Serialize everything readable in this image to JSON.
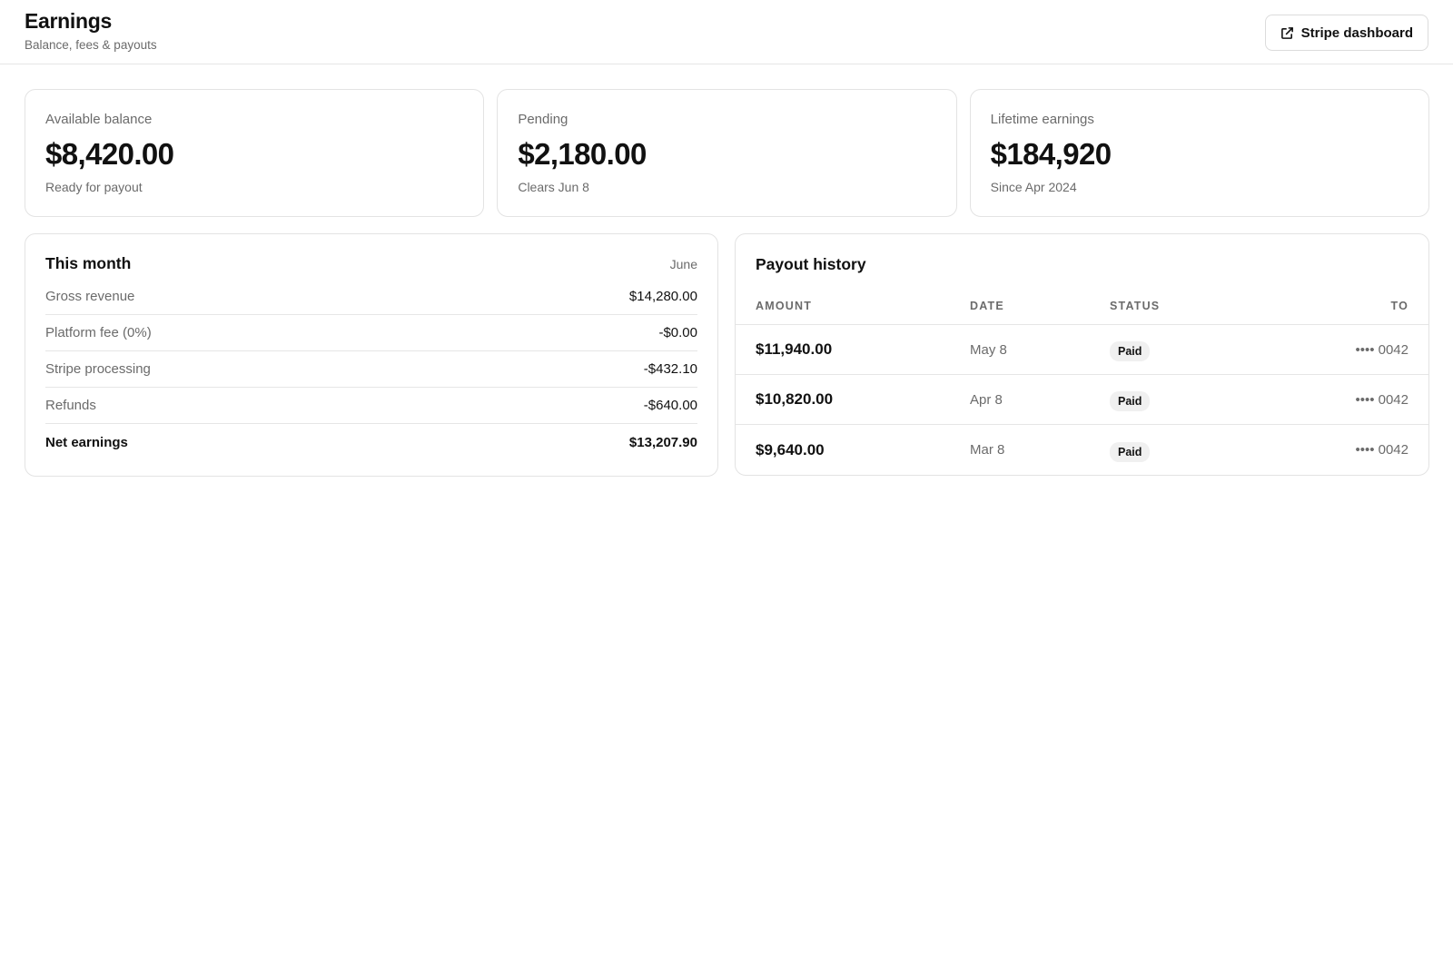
{
  "header": {
    "title": "Earnings",
    "subtitle": "Balance, fees & payouts",
    "stripe_button_label": "Stripe dashboard",
    "stripe_button_icon": "external-link-icon"
  },
  "stats": [
    {
      "label": "Available balance",
      "value": "$8,420.00",
      "note": "Ready for payout"
    },
    {
      "label": "Pending",
      "value": "$2,180.00",
      "note": "Clears Jun 8"
    },
    {
      "label": "Lifetime earnings",
      "value": "$184,920",
      "note": "Since Apr 2024"
    }
  ],
  "this_month": {
    "title": "This month",
    "month": "June",
    "rows": [
      {
        "label": "Gross revenue",
        "value": "$14,280.00"
      },
      {
        "label": "Platform fee (0%)",
        "value": "-$0.00"
      },
      {
        "label": "Stripe processing",
        "value": "-$432.10"
      },
      {
        "label": "Refunds",
        "value": "-$640.00"
      },
      {
        "label": "Net earnings",
        "value": "$13,207.90"
      }
    ]
  },
  "payout_history": {
    "title": "Payout history",
    "columns": {
      "amount": "AMOUNT",
      "date": "DATE",
      "status": "STATUS",
      "to": "TO"
    },
    "rows": [
      {
        "amount": "$11,940.00",
        "date": "May 8",
        "status": "Paid",
        "to": "•••• 0042"
      },
      {
        "amount": "$10,820.00",
        "date": "Apr 8",
        "status": "Paid",
        "to": "•••• 0042"
      },
      {
        "amount": "$9,640.00",
        "date": "Mar 8",
        "status": "Paid",
        "to": "•••• 0042"
      }
    ]
  }
}
